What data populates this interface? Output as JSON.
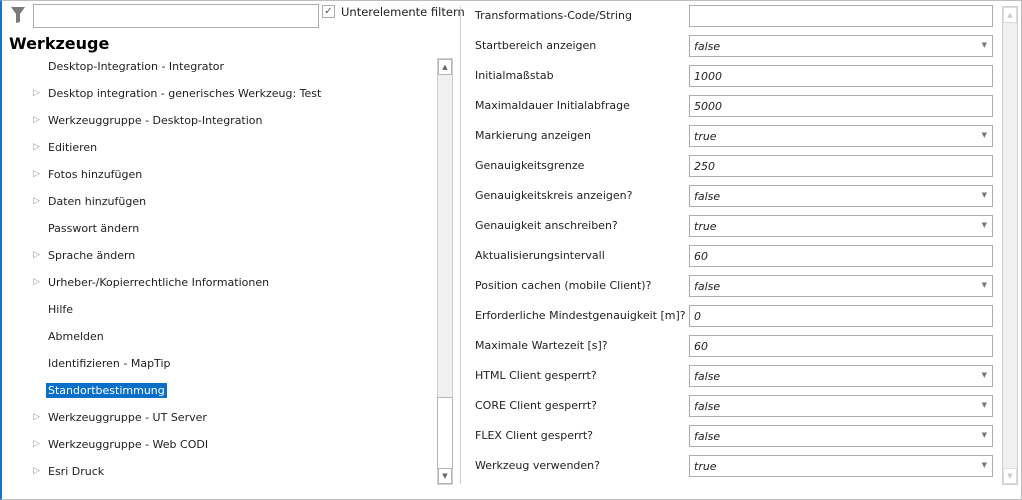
{
  "filter": {
    "search_value": "",
    "checkbox_label": "Unterelemente filtern",
    "checked": true
  },
  "heading": "Werkzeuge",
  "tree": [
    {
      "label": "Desktop-Integration - Integrator",
      "expandable": false
    },
    {
      "label": "Desktop integration - generisches Werkzeug: Test",
      "expandable": true
    },
    {
      "label": "Werkzeuggruppe - Desktop-Integration",
      "expandable": true
    },
    {
      "label": "Editieren",
      "expandable": true
    },
    {
      "label": "Fotos hinzufügen",
      "expandable": true
    },
    {
      "label": "Daten hinzufügen",
      "expandable": true
    },
    {
      "label": "Passwort ändern",
      "expandable": false
    },
    {
      "label": "Sprache ändern",
      "expandable": true
    },
    {
      "label": "Urheber-/Kopierrechtliche Informationen",
      "expandable": true
    },
    {
      "label": "Hilfe",
      "expandable": false
    },
    {
      "label": "Abmelden",
      "expandable": false
    },
    {
      "label": "Identifizieren - MapTip",
      "expandable": false
    },
    {
      "label": "Standortbestimmung",
      "expandable": false,
      "selected": true
    },
    {
      "label": "Werkzeuggruppe - UT Server",
      "expandable": true
    },
    {
      "label": "Werkzeuggruppe - Web CODI",
      "expandable": true
    },
    {
      "label": "Esri Druck",
      "expandable": true
    }
  ],
  "properties": [
    {
      "label": "Transformations-Code/String",
      "value": "",
      "type": "text"
    },
    {
      "label": "Startbereich anzeigen",
      "value": "false",
      "type": "select"
    },
    {
      "label": "Initialmaßstab",
      "value": "1000",
      "type": "text"
    },
    {
      "label": "Maximaldauer Initialabfrage",
      "value": "5000",
      "type": "text"
    },
    {
      "label": "Markierung anzeigen",
      "value": "true",
      "type": "select"
    },
    {
      "label": "Genauigkeitsgrenze",
      "value": "250",
      "type": "text"
    },
    {
      "label": "Genauigkeitskreis anzeigen?",
      "value": "false",
      "type": "select"
    },
    {
      "label": "Genauigkeit anschreiben?",
      "value": "true",
      "type": "select"
    },
    {
      "label": "Aktualisierungsintervall",
      "value": "60",
      "type": "text"
    },
    {
      "label": "Position cachen (mobile Client)?",
      "value": "false",
      "type": "select"
    },
    {
      "label": "Erforderliche Mindestgenauigkeit [m]?",
      "value": "0",
      "type": "text"
    },
    {
      "label": "Maximale Wartezeit [s]?",
      "value": "60",
      "type": "text"
    },
    {
      "label": "HTML Client gesperrt?",
      "value": "false",
      "type": "select"
    },
    {
      "label": "CORE Client gesperrt?",
      "value": "false",
      "type": "select"
    },
    {
      "label": "FLEX Client gesperrt?",
      "value": "false",
      "type": "select"
    },
    {
      "label": "Werkzeug verwenden?",
      "value": "true",
      "type": "select"
    }
  ],
  "icons": {
    "filter": "filter-funnel-icon",
    "expand": "triangle-right-icon",
    "dropdown": "chevron-down-icon"
  }
}
